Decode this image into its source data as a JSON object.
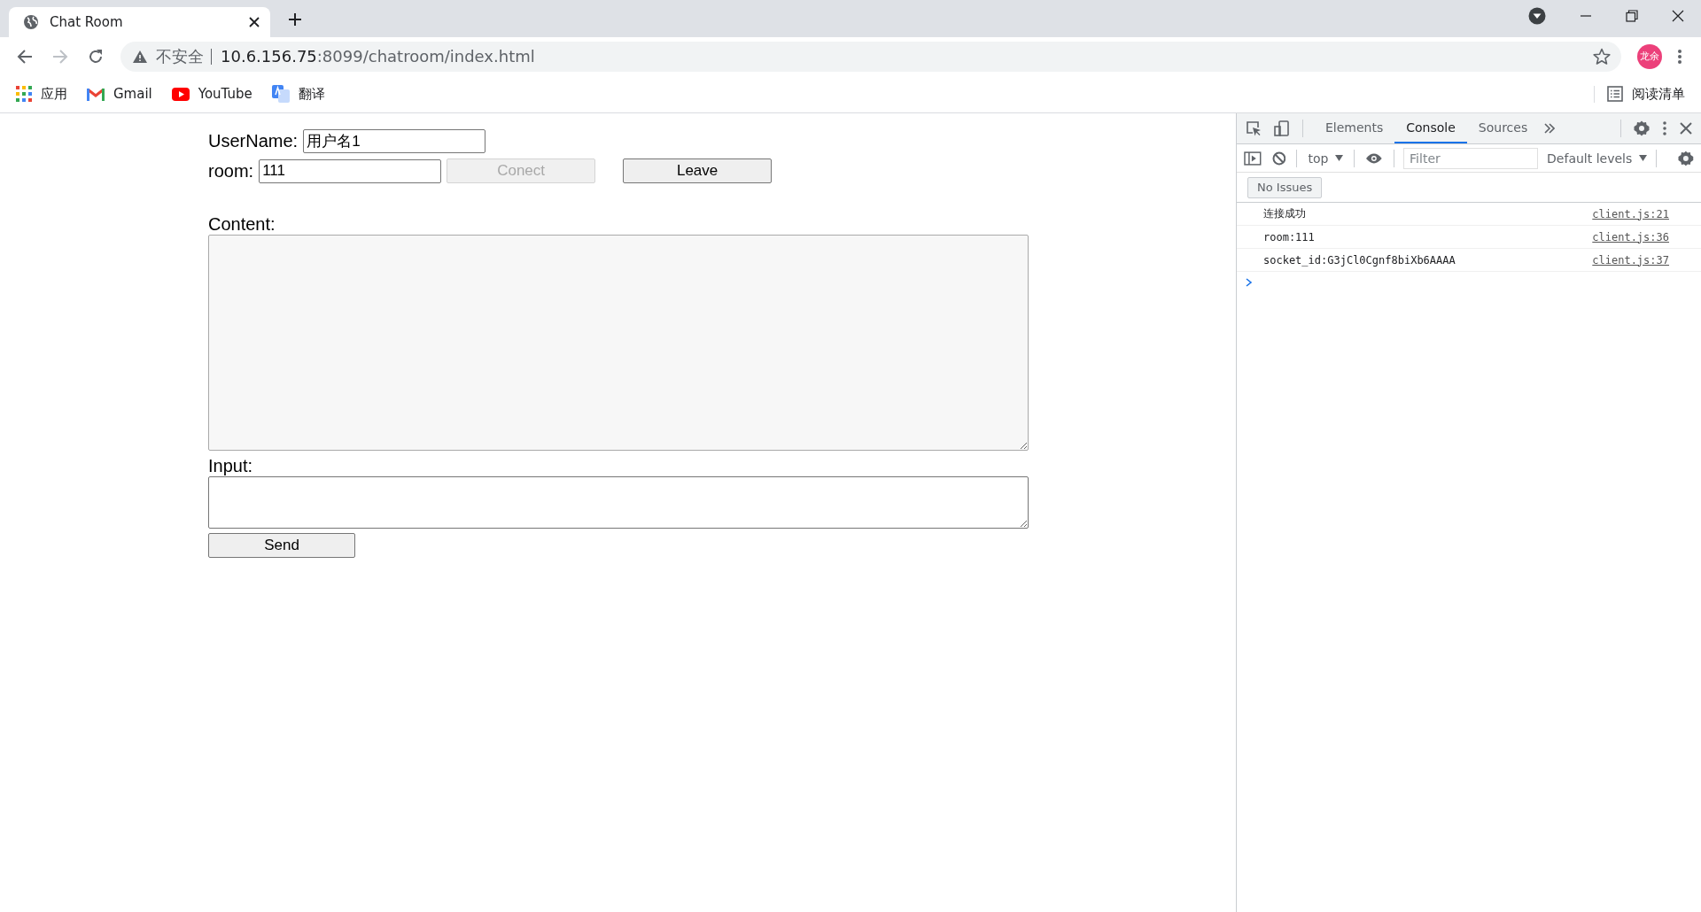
{
  "browser": {
    "tabs": [
      {
        "title": "Chat Room",
        "selected": true
      }
    ],
    "address": {
      "security": "不安全",
      "host": "10.6.156.75",
      "path": ":8099/chatroom/index.html"
    },
    "profile": "龙余",
    "bookmarks": [
      {
        "kind": "apps",
        "label": "应用"
      },
      {
        "kind": "gmail",
        "label": "Gmail"
      },
      {
        "kind": "youtube",
        "label": "YouTube"
      },
      {
        "kind": "translate",
        "label": "翻译"
      }
    ],
    "reading_list": "阅读清单"
  },
  "page": {
    "username": {
      "label": "UserName:",
      "value": "用户名1"
    },
    "room": {
      "label": "room:",
      "value": "111"
    },
    "buttons": [
      {
        "label": "Conect",
        "disabled": true
      },
      {
        "label": "Leave",
        "disabled": false
      }
    ],
    "content": {
      "label": "Content:"
    },
    "input": {
      "label": "Input:"
    },
    "send": "Send"
  },
  "devtools": {
    "tabs": [
      {
        "label": "Elements",
        "selected": false
      },
      {
        "label": "Console",
        "selected": true
      },
      {
        "label": "Sources",
        "selected": false
      }
    ],
    "context": "top",
    "filter": {
      "placeholder": "Filter"
    },
    "levels": "Default levels",
    "issues": "No Issues",
    "messages": [
      {
        "text": "连接成功",
        "source": "client.js:21"
      },
      {
        "text": "room:111",
        "source": "client.js:36"
      },
      {
        "text": "socket_id:G3jCl0Cgnf8biXb6AAAA",
        "source": "client.js:37"
      }
    ]
  }
}
